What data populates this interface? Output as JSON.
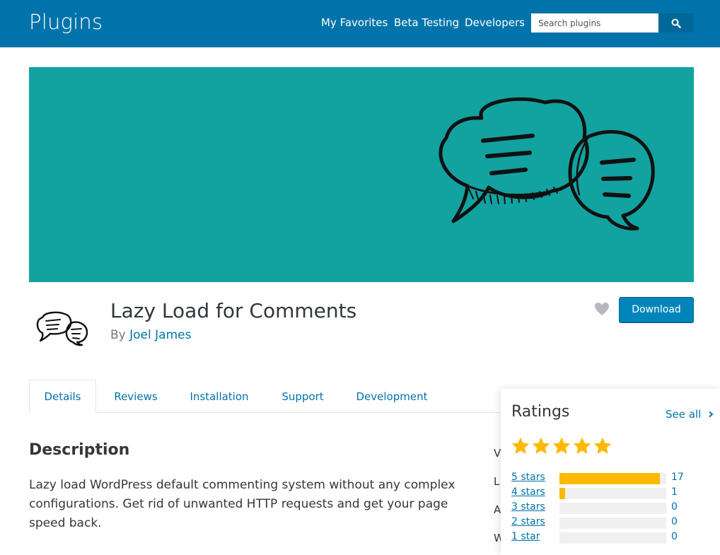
{
  "header": {
    "brand": "Plugins",
    "nav": [
      {
        "label": "My Favorites"
      },
      {
        "label": "Beta Testing"
      },
      {
        "label": "Developers"
      }
    ],
    "search_placeholder": "Search plugins"
  },
  "colors": {
    "header_bg": "#0073aa",
    "banner_bg": "#12a2a0",
    "link": "#0073aa",
    "star": "#ffb900"
  },
  "plugin": {
    "title": "Lazy Load for Comments",
    "by": "By",
    "author": "Joel James",
    "download_label": "Download"
  },
  "tabs": [
    {
      "label": "Details",
      "active": true
    },
    {
      "label": "Reviews",
      "active": false
    },
    {
      "label": "Installation",
      "active": false
    },
    {
      "label": "Support",
      "active": false
    },
    {
      "label": "Development",
      "active": false
    }
  ],
  "description": {
    "title": "Description",
    "text": "Lazy load WordPress default commenting system without any complex configurations. Get rid of unwanted HTTP requests and get your page speed back."
  },
  "meta_letters": [
    "V",
    "L",
    "A",
    "W"
  ],
  "ratings": {
    "title": "Ratings",
    "see_all": "See all",
    "stars_filled": 5,
    "rows": [
      {
        "label": "5 stars",
        "count": "17",
        "fraction": 0.94
      },
      {
        "label": "4 stars",
        "count": "1",
        "fraction": 0.055
      },
      {
        "label": "3 stars",
        "count": "0",
        "fraction": 0
      },
      {
        "label": "2 stars",
        "count": "0",
        "fraction": 0
      },
      {
        "label": "1 star",
        "count": "0",
        "fraction": 0
      }
    ]
  }
}
